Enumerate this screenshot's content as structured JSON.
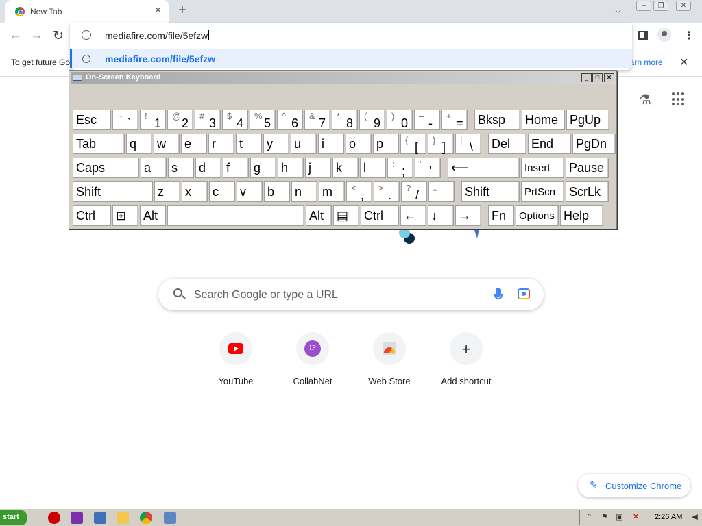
{
  "browser": {
    "tab_title": "New Tab",
    "tab_close_icon": "close-icon",
    "new_tab_label": "+",
    "tabs_dropdown_label": "⌵",
    "window_minimize": "–",
    "window_restore": "❐",
    "window_close": "✕"
  },
  "toolbar": {
    "back_label": "←",
    "forward_label": "→",
    "reload_label": "↻",
    "omnibox_value": "mediafire.com/file/5efzw",
    "suggestion_text": "mediafire.com/file/5efzw",
    "menu_label": "⋮"
  },
  "infobar": {
    "text": "To get future Go",
    "link": "earn more",
    "close_label": "✕"
  },
  "ntp": {
    "search_placeholder": "Search Google or type a URL",
    "labs_label": "⚗",
    "shortcuts": [
      {
        "label": "YouTube"
      },
      {
        "label": "CollabNet",
        "icon_text": "IP"
      },
      {
        "label": "Web Store"
      },
      {
        "label": "Add shortcut",
        "icon_text": "+"
      }
    ],
    "customize_label": "Customize Chrome",
    "customize_icon": "✎"
  },
  "osk": {
    "title": "On-Screen Keyboard",
    "controls": [
      "_",
      "□",
      "✕"
    ],
    "rows": [
      [
        {
          "main": "Esc"
        },
        {
          "shifted": "~",
          "base": "`"
        },
        {
          "shifted": "!",
          "base": "1"
        },
        {
          "shifted": "@",
          "base": "2"
        },
        {
          "shifted": "#",
          "base": "3"
        },
        {
          "shifted": "$",
          "base": "4"
        },
        {
          "shifted": "%",
          "base": "5"
        },
        {
          "shifted": "^",
          "base": "6"
        },
        {
          "shifted": "&",
          "base": "7"
        },
        {
          "shifted": "*",
          "base": "8"
        },
        {
          "shifted": "(",
          "base": "9"
        },
        {
          "shifted": ")",
          "base": "0"
        },
        {
          "shifted": "–",
          "base": "-"
        },
        {
          "shifted": "+",
          "base": "="
        },
        {
          "main": "Bksp"
        },
        {
          "main": "Home"
        },
        {
          "main": "PgUp"
        }
      ],
      [
        {
          "main": "Tab"
        },
        {
          "main": "q"
        },
        {
          "main": "w"
        },
        {
          "main": "e"
        },
        {
          "main": "r"
        },
        {
          "main": "t"
        },
        {
          "main": "y"
        },
        {
          "main": "u"
        },
        {
          "main": "i"
        },
        {
          "main": "o"
        },
        {
          "main": "p"
        },
        {
          "shifted": "{",
          "base": "["
        },
        {
          "shifted": "}",
          "base": "]"
        },
        {
          "shifted": "|",
          "base": "\\"
        },
        {
          "main": "Del"
        },
        {
          "main": "End"
        },
        {
          "main": "PgDn"
        }
      ],
      [
        {
          "main": "Caps"
        },
        {
          "main": "a"
        },
        {
          "main": "s"
        },
        {
          "main": "d"
        },
        {
          "main": "f"
        },
        {
          "main": "g"
        },
        {
          "main": "h"
        },
        {
          "main": "j"
        },
        {
          "main": "k"
        },
        {
          "main": "l"
        },
        {
          "shifted": ":",
          "base": ";"
        },
        {
          "shifted": "\"",
          "base": "'"
        },
        {
          "main": "⟵"
        },
        {
          "main": "Insert"
        },
        {
          "main": "Pause"
        }
      ],
      [
        {
          "main": "Shift"
        },
        {
          "main": "z"
        },
        {
          "main": "x"
        },
        {
          "main": "c"
        },
        {
          "main": "v"
        },
        {
          "main": "b"
        },
        {
          "main": "n"
        },
        {
          "main": "m"
        },
        {
          "shifted": "<",
          "base": ","
        },
        {
          "shifted": ">",
          "base": "."
        },
        {
          "shifted": "?",
          "base": "/"
        },
        {
          "main": "↑"
        },
        {
          "main": "Shift"
        },
        {
          "main": "PrtScn"
        },
        {
          "main": "ScrLk"
        }
      ],
      [
        {
          "main": "Ctrl"
        },
        {
          "main": "⊞"
        },
        {
          "main": "Alt"
        },
        {
          "main": ""
        },
        {
          "main": "Alt"
        },
        {
          "main": "▤"
        },
        {
          "main": "Ctrl"
        },
        {
          "main": "←"
        },
        {
          "main": "↓"
        },
        {
          "main": "→"
        },
        {
          "main": "Fn"
        },
        {
          "main": "Options"
        },
        {
          "main": "Help"
        }
      ]
    ]
  },
  "taskbar": {
    "start_label": "start",
    "clock": "2:26 AM",
    "tray_chevron": "⌃"
  }
}
